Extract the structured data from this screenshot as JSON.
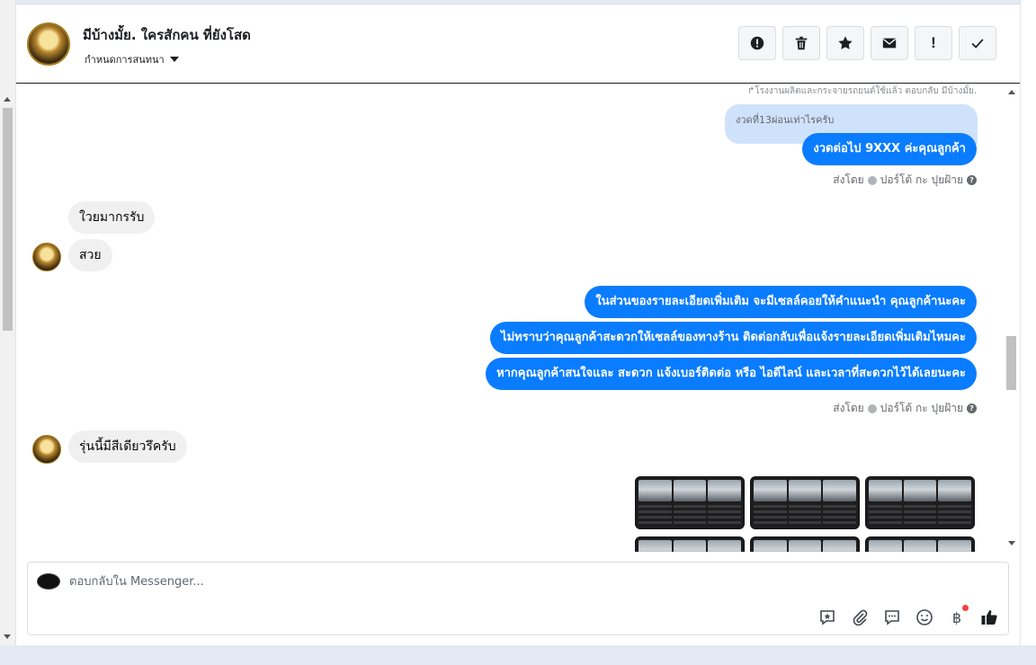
{
  "header": {
    "contact_name": "มีบ้างมั้ย. ใครสักคน ที่ยังโสด",
    "assign_label": "กำหนดการสนทนา",
    "actions": [
      {
        "name": "spam-icon"
      },
      {
        "name": "trash-icon"
      },
      {
        "name": "star-icon"
      },
      {
        "name": "envelope-icon"
      },
      {
        "name": "follow-up-icon",
        "glyph": "!"
      },
      {
        "name": "check-icon"
      }
    ]
  },
  "messages": {
    "reply_note": "↱โรงงานผลิตและกระจายรถยนต์ใช้แล้ว ตอบกลับ มีบ้างมั้ย.",
    "quoted_text": "งวดที่13ผ่อนเท่าไรครับ",
    "out_1": "งวดต่อไป 9XXX ค่ะคุณลูกค้า",
    "sent_by_1": {
      "prefix": "ส่งโดย",
      "name": "ปอร์โต้ กะ ปุยฝ้าย"
    },
    "in_1": "ใวยมากรรับ",
    "in_2": "สวย",
    "out_2": "ในส่วนของรายละเอียดเพิ่มเติม จะมีเซลล์คอยให้คำแนะนำ คุณลูกค้านะคะ",
    "out_3": "ไม่ทราบว่าคุณลูกค้าสะดวกให้เซลล์ของทางร้าน ติดต่อกลับเพื่อแจ้งรายละเอียดเพิ่มเติมไหมคะ",
    "out_4": "หากคุณลูกค้าสนใจและ สะดวก แจ้งเบอร์ติดต่อ หรือ ไอดีไลน์ และเวลาที่สะดวกไว้ได้เลยนะคะ",
    "sent_by_2": {
      "prefix": "ส่งโดย",
      "name": "ปอร์โต้ กะ ปุยฝ้าย"
    },
    "in_3": "รุ่นนี้มีสีเดียวรึครับ"
  },
  "composer": {
    "placeholder": "ตอบกลับใน Messenger...",
    "tools": [
      "saved-reply-icon",
      "attachment-icon",
      "chat-icon",
      "emoji-icon",
      "payment-icon",
      "like-icon"
    ],
    "payment_glyph": "฿"
  },
  "colors": {
    "outgoing_bubble": "#0a7cff",
    "incoming_bubble": "#f0f0f0",
    "quoted_bubble": "#cfe2fb"
  }
}
